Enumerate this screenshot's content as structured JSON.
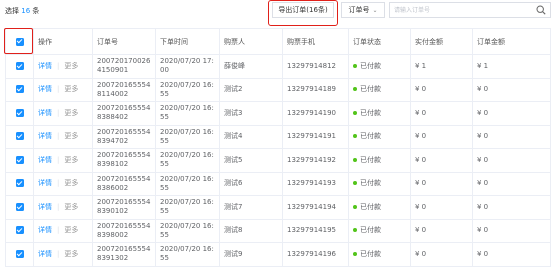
{
  "toolbar": {
    "selected_prefix": "选择",
    "selected_count": "16",
    "selected_suffix": "条",
    "export_label": "导出订单(16条)",
    "order_dropdown_label": "订单号",
    "search_placeholder": "请输入订单号"
  },
  "table": {
    "columns": [
      "操作",
      "订单号",
      "下单时间",
      "购票人",
      "购票手机",
      "订单状态",
      "实付金额",
      "订单金额"
    ],
    "detail_label": "详情",
    "more_label": "更多",
    "rows": [
      {
        "order_no_1": "200720170026",
        "order_no_2": "4150901",
        "time_1": "2020/07/20 17:",
        "time_2": "00",
        "buyer": "薛俊峰",
        "phone": "13297914812",
        "status": "已付款",
        "paid": "¥ 1",
        "amount": "¥ 1"
      },
      {
        "order_no_1": "200720165554",
        "order_no_2": "8114002",
        "time_1": "2020/07/20 16:",
        "time_2": "55",
        "buyer": "测试2",
        "phone": "13297914189",
        "status": "已付款",
        "paid": "¥ 0",
        "amount": "¥ 0"
      },
      {
        "order_no_1": "200720165554",
        "order_no_2": "8388402",
        "time_1": "2020/07/20 16:",
        "time_2": "55",
        "buyer": "测试3",
        "phone": "13297914190",
        "status": "已付款",
        "paid": "¥ 0",
        "amount": "¥ 0"
      },
      {
        "order_no_1": "200720165554",
        "order_no_2": "8394702",
        "time_1": "2020/07/20 16:",
        "time_2": "55",
        "buyer": "测试4",
        "phone": "13297914191",
        "status": "已付款",
        "paid": "¥ 0",
        "amount": "¥ 0"
      },
      {
        "order_no_1": "200720165554",
        "order_no_2": "8398102",
        "time_1": "2020/07/20 16:",
        "time_2": "55",
        "buyer": "测试5",
        "phone": "13297914192",
        "status": "已付款",
        "paid": "¥ 0",
        "amount": "¥ 0"
      },
      {
        "order_no_1": "200720165554",
        "order_no_2": "8386002",
        "time_1": "2020/07/20 16:",
        "time_2": "55",
        "buyer": "测试6",
        "phone": "13297914193",
        "status": "已付款",
        "paid": "¥ 0",
        "amount": "¥ 0"
      },
      {
        "order_no_1": "200720165554",
        "order_no_2": "8390102",
        "time_1": "2020/07/20 16:",
        "time_2": "55",
        "buyer": "测试7",
        "phone": "13297914194",
        "status": "已付款",
        "paid": "¥ 0",
        "amount": "¥ 0"
      },
      {
        "order_no_1": "200720165554",
        "order_no_2": "8398002",
        "time_1": "2020/07/20 16:",
        "time_2": "55",
        "buyer": "测试8",
        "phone": "13297914195",
        "status": "已付款",
        "paid": "¥ 0",
        "amount": "¥ 0"
      },
      {
        "order_no_1": "200720165554",
        "order_no_2": "8391302",
        "time_1": "2020/07/20 16:",
        "time_2": "55",
        "buyer": "测试9",
        "phone": "13297914196",
        "status": "已付款",
        "paid": "¥ 0",
        "amount": "¥ 0"
      }
    ]
  },
  "colors": {
    "accent": "#1890ff",
    "status_dot": "#52c41a",
    "highlight_box": "#e0201a"
  },
  "icons": {
    "search": "search-icon",
    "dropdown": "chevron-down-icon",
    "checkbox": "checkbox-checked-icon"
  }
}
